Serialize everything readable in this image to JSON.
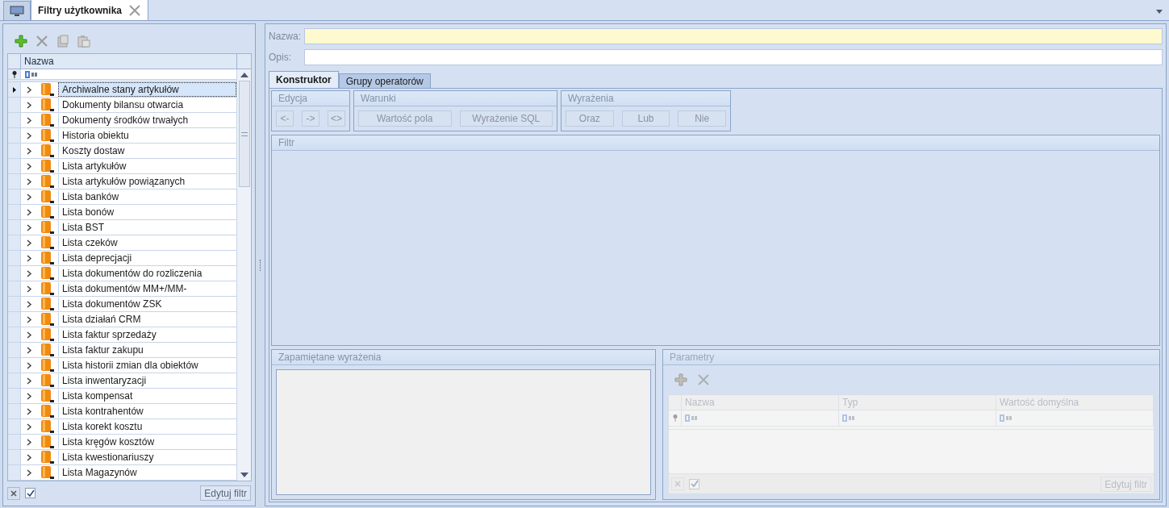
{
  "doc_tab": {
    "label": "Filtry użytkownika",
    "selected": true
  },
  "left": {
    "column": "Nazwa",
    "rows": [
      {
        "label": "Archiwalne stany artykułów",
        "selected": true,
        "expanded": false
      },
      {
        "label": "Dokumenty bilansu otwarcia",
        "selected": false,
        "expanded": false
      },
      {
        "label": "Dokumenty środków trwałych",
        "selected": false,
        "expanded": false
      },
      {
        "label": "Historia obiektu",
        "selected": false,
        "expanded": false
      },
      {
        "label": "Koszty dostaw",
        "selected": false,
        "expanded": false
      },
      {
        "label": "Lista artykułów",
        "selected": false,
        "expanded": false
      },
      {
        "label": "Lista artykułów powiązanych",
        "selected": false,
        "expanded": false
      },
      {
        "label": "Lista banków",
        "selected": false,
        "expanded": false
      },
      {
        "label": "Lista bonów",
        "selected": false,
        "expanded": false
      },
      {
        "label": "Lista BST",
        "selected": false,
        "expanded": false
      },
      {
        "label": "Lista czeków",
        "selected": false,
        "expanded": false
      },
      {
        "label": "Lista deprecjacji",
        "selected": false,
        "expanded": false
      },
      {
        "label": "Lista dokumentów do rozliczenia",
        "selected": false,
        "expanded": false
      },
      {
        "label": "Lista dokumentów MM+/MM-",
        "selected": false,
        "expanded": false
      },
      {
        "label": "Lista dokumentów ZSK",
        "selected": false,
        "expanded": false
      },
      {
        "label": "Lista działań CRM",
        "selected": false,
        "expanded": false
      },
      {
        "label": "Lista faktur sprzedaży",
        "selected": false,
        "expanded": false
      },
      {
        "label": "Lista faktur zakupu",
        "selected": false,
        "expanded": false
      },
      {
        "label": "Lista historii zmian dla obiektów",
        "selected": false,
        "expanded": false
      },
      {
        "label": "Lista inwentaryzacji",
        "selected": false,
        "expanded": false
      },
      {
        "label": "Lista kompensat",
        "selected": false,
        "expanded": false
      },
      {
        "label": "Lista kontrahentów",
        "selected": false,
        "expanded": false
      },
      {
        "label": "Lista korekt kosztu",
        "selected": false,
        "expanded": false
      },
      {
        "label": "Lista kręgów kosztów",
        "selected": false,
        "expanded": false
      },
      {
        "label": "Lista kwestionariuszy",
        "selected": false,
        "expanded": false
      },
      {
        "label": "Lista Magazynów",
        "selected": false,
        "expanded": false
      }
    ],
    "apply_checked": true,
    "edit_button": "Edytuj filtr"
  },
  "form": {
    "name_label": "Nazwa:",
    "desc_label": "Opis:"
  },
  "tabs": [
    {
      "label": "Konstruktor",
      "selected": true
    },
    {
      "label": "Grupy operatorów",
      "selected": false
    }
  ],
  "groups": [
    {
      "title": "Edycja",
      "buttons": [
        "<-",
        "->",
        "<>"
      ]
    },
    {
      "title": "Warunki",
      "buttons": [
        "Wartość pola",
        "Wyrażenie SQL"
      ]
    },
    {
      "title": "Wyrażenia",
      "buttons": [
        "Oraz",
        "Lub",
        "Nie"
      ]
    }
  ],
  "filter_title": "Filtr",
  "saved_title": "Zapamiętane wyrażenia",
  "params": {
    "title": "Parametry",
    "disabled": true,
    "columns": [
      "Nazwa",
      "Typ",
      "Wartość domyślna"
    ],
    "edit_button": "Edytuj filtr",
    "apply_checked": true
  }
}
